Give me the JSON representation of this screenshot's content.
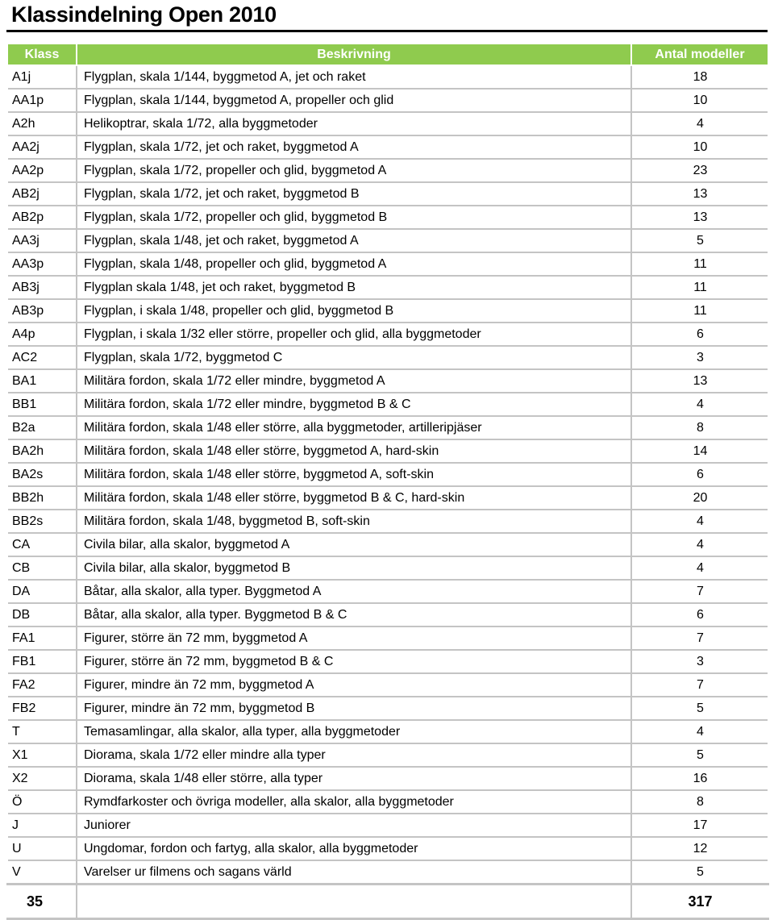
{
  "document": {
    "title": "Klassindelning Open 2010"
  },
  "theme": {
    "header_green": "#8FCB4E",
    "header_text": "#FFFFFF",
    "grid_line": "#C4C4C4",
    "body_text": "#000000",
    "background": "#FFFFFF"
  },
  "table": {
    "columns": [
      {
        "key": "klass",
        "label": "Klass",
        "align": "center"
      },
      {
        "key": "beskrivning",
        "label": "Beskrivning",
        "align": "center"
      },
      {
        "key": "antal",
        "label": "Antal modeller",
        "align": "center"
      }
    ],
    "rows": [
      {
        "klass": "A1j",
        "beskrivning": "Flygplan, skala 1/144, byggmetod A, jet och raket",
        "antal": "18"
      },
      {
        "klass": "AA1p",
        "beskrivning": "Flygplan, skala 1/144, byggmetod A, propeller och glid",
        "antal": "10"
      },
      {
        "klass": "A2h",
        "beskrivning": "Helikoptrar, skala 1/72, alla byggmetoder",
        "antal": "4"
      },
      {
        "klass": "AA2j",
        "beskrivning": "Flygplan, skala 1/72, jet och raket, byggmetod A",
        "antal": "10"
      },
      {
        "klass": "AA2p",
        "beskrivning": "Flygplan, skala 1/72, propeller och glid, byggmetod A",
        "antal": "23"
      },
      {
        "klass": "AB2j",
        "beskrivning": "Flygplan, skala 1/72, jet och raket, byggmetod B",
        "antal": "13"
      },
      {
        "klass": "AB2p",
        "beskrivning": "Flygplan, skala 1/72, propeller och glid, byggmetod B",
        "antal": "13"
      },
      {
        "klass": "AA3j",
        "beskrivning": "Flygplan, skala 1/48, jet och raket, byggmetod A",
        "antal": "5"
      },
      {
        "klass": "AA3p",
        "beskrivning": "Flygplan, skala 1/48, propeller och glid, byggmetod A",
        "antal": "11"
      },
      {
        "klass": "AB3j",
        "beskrivning": "Flygplan skala 1/48, jet och raket, byggmetod B",
        "antal": "11"
      },
      {
        "klass": "AB3p",
        "beskrivning": "Flygplan, i skala 1/48, propeller och glid, byggmetod B",
        "antal": "11"
      },
      {
        "klass": "A4p",
        "beskrivning": "Flygplan, i skala 1/32 eller större, propeller och glid, alla byggmetoder",
        "antal": "6"
      },
      {
        "klass": "AC2",
        "beskrivning": "Flygplan, skala 1/72, byggmetod C",
        "antal": "3"
      },
      {
        "klass": "BA1",
        "beskrivning": "Militära fordon, skala 1/72 eller mindre, byggmetod A",
        "antal": "13"
      },
      {
        "klass": "BB1",
        "beskrivning": "Militära fordon, skala 1/72 eller mindre, byggmetod B & C",
        "antal": "4"
      },
      {
        "klass": "B2a",
        "beskrivning": "Militära fordon, skala 1/48 eller större, alla byggmetoder, artilleripjäser",
        "antal": "8"
      },
      {
        "klass": "BA2h",
        "beskrivning": "Militära fordon, skala 1/48 eller större, byggmetod A, hard-skin",
        "antal": "14"
      },
      {
        "klass": "BA2s",
        "beskrivning": "Militära fordon, skala 1/48 eller större, byggmetod A, soft-skin",
        "antal": "6"
      },
      {
        "klass": "BB2h",
        "beskrivning": "Militära fordon, skala 1/48 eller större, byggmetod B & C, hard-skin",
        "antal": "20"
      },
      {
        "klass": "BB2s",
        "beskrivning": "Militära fordon, skala 1/48, byggmetod B, soft-skin",
        "antal": "4"
      },
      {
        "klass": "CA",
        "beskrivning": "Civila bilar, alla skalor, byggmetod A",
        "antal": "4"
      },
      {
        "klass": "CB",
        "beskrivning": "Civila bilar, alla skalor, byggmetod B",
        "antal": "4"
      },
      {
        "klass": "DA",
        "beskrivning": "Båtar, alla skalor, alla typer. Byggmetod A",
        "antal": "7"
      },
      {
        "klass": "DB",
        "beskrivning": "Båtar, alla skalor, alla typer. Byggmetod B & C",
        "antal": "6"
      },
      {
        "klass": "FA1",
        "beskrivning": "Figurer, större än 72 mm, byggmetod A",
        "antal": "7"
      },
      {
        "klass": "FB1",
        "beskrivning": "Figurer, större än 72 mm, byggmetod B & C",
        "antal": "3"
      },
      {
        "klass": "FA2",
        "beskrivning": "Figurer, mindre än 72 mm, byggmetod A",
        "antal": "7"
      },
      {
        "klass": "FB2",
        "beskrivning": "Figurer, mindre än 72 mm, byggmetod B",
        "antal": "5"
      },
      {
        "klass": "T",
        "beskrivning": "Temasamlingar, alla skalor, alla typer, alla byggmetoder",
        "antal": "4"
      },
      {
        "klass": "X1",
        "beskrivning": "Diorama, skala 1/72 eller mindre alla typer",
        "antal": "5"
      },
      {
        "klass": "X2",
        "beskrivning": "Diorama, skala 1/48 eller större, alla typer",
        "antal": "16"
      },
      {
        "klass": "Ö",
        "beskrivning": "Rymdfarkoster och övriga modeller, alla skalor, alla byggmetoder",
        "antal": "8"
      },
      {
        "klass": "J",
        "beskrivning": "Juniorer",
        "antal": "17"
      },
      {
        "klass": "U",
        "beskrivning": "Ungdomar, fordon och fartyg, alla skalor, alla byggmetoder",
        "antal": "12"
      },
      {
        "klass": "V",
        "beskrivning": "Varelser ur filmens och sagans värld",
        "antal": "5"
      }
    ],
    "totals": {
      "klass_count": "35",
      "beskrivning": "",
      "antal_sum": "317"
    }
  }
}
